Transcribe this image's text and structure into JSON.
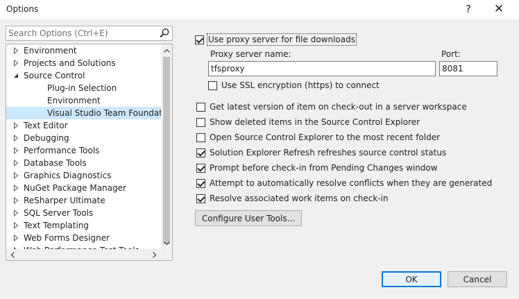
{
  "window": {
    "title": "Options",
    "help_glyph": "?",
    "close_glyph": "✕"
  },
  "search": {
    "placeholder": "Search Options (Ctrl+E)",
    "icon": "search-icon"
  },
  "tree": {
    "items": [
      {
        "label": "Environment",
        "level": 0,
        "expanded": false,
        "selected": false
      },
      {
        "label": "Projects and Solutions",
        "level": 0,
        "expanded": false,
        "selected": false
      },
      {
        "label": "Source Control",
        "level": 0,
        "expanded": true,
        "selected": false
      },
      {
        "label": "Plug-in Selection",
        "level": 1,
        "expanded": null,
        "selected": false
      },
      {
        "label": "Environment",
        "level": 1,
        "expanded": null,
        "selected": false
      },
      {
        "label": "Visual Studio Team Foundation Server",
        "level": 1,
        "expanded": null,
        "selected": true
      },
      {
        "label": "Text Editor",
        "level": 0,
        "expanded": false,
        "selected": false
      },
      {
        "label": "Debugging",
        "level": 0,
        "expanded": false,
        "selected": false
      },
      {
        "label": "Performance Tools",
        "level": 0,
        "expanded": false,
        "selected": false
      },
      {
        "label": "Database Tools",
        "level": 0,
        "expanded": false,
        "selected": false
      },
      {
        "label": "Graphics Diagnostics",
        "level": 0,
        "expanded": false,
        "selected": false
      },
      {
        "label": "NuGet Package Manager",
        "level": 0,
        "expanded": false,
        "selected": false
      },
      {
        "label": "ReSharper Ultimate",
        "level": 0,
        "expanded": false,
        "selected": false
      },
      {
        "label": "SQL Server Tools",
        "level": 0,
        "expanded": false,
        "selected": false
      },
      {
        "label": "Text Templating",
        "level": 0,
        "expanded": false,
        "selected": false
      },
      {
        "label": "Web Forms Designer",
        "level": 0,
        "expanded": false,
        "selected": false
      },
      {
        "label": "Web Performance Test Tools",
        "level": 0,
        "expanded": false,
        "selected": false
      }
    ]
  },
  "proxy": {
    "use_proxy_label": "Use proxy server for file downloads",
    "use_proxy_checked": true,
    "server_name_label": "Proxy server name:",
    "server_name_value": "tfsproxy",
    "port_label": "Port:",
    "port_value": "8081",
    "use_ssl_label": "Use SSL encryption (https) to connect",
    "use_ssl_checked": false
  },
  "options": [
    {
      "label": "Get latest version of item on check-out in a server workspace",
      "checked": false
    },
    {
      "label": "Show deleted items in the Source Control Explorer",
      "checked": false
    },
    {
      "label": "Open Source Control Explorer to the most recent folder",
      "checked": false
    },
    {
      "label": "Solution Explorer Refresh refreshes source control status",
      "checked": true
    },
    {
      "label": "Prompt before check-in from Pending Changes window",
      "checked": true
    },
    {
      "label": "Attempt to automatically resolve conflicts when they are generated",
      "checked": true
    },
    {
      "label": "Resolve associated work items on check-in",
      "checked": true
    }
  ],
  "buttons": {
    "configure_tools": "Configure User Tools...",
    "ok": "OK",
    "cancel": "Cancel"
  },
  "colors": {
    "selection": "#cce8ff",
    "primary_border": "#0078d7"
  }
}
